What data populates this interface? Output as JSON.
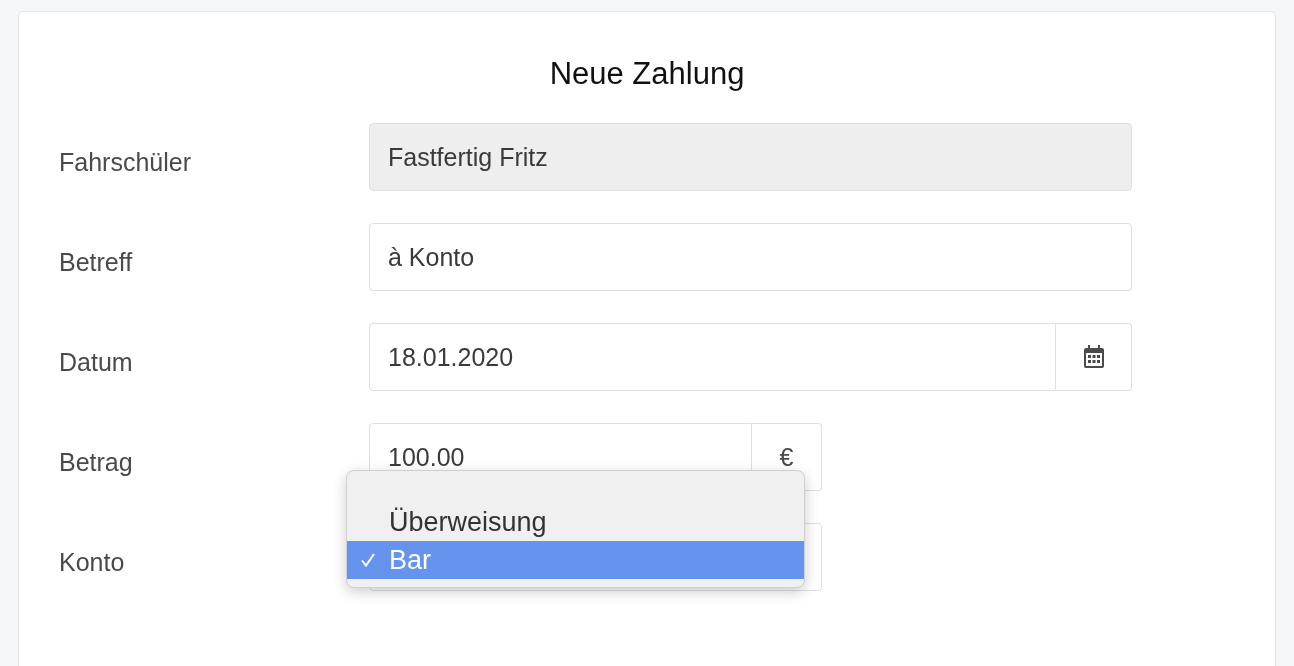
{
  "title": "Neue Zahlung",
  "fields": [
    {
      "kind": "readonly",
      "label": "Fahrschüler",
      "value": "Fastfertig Fritz"
    },
    {
      "kind": "text",
      "label": "Betreff",
      "value": "à Konto"
    },
    {
      "kind": "date",
      "label": "Datum",
      "value": "18.01.2020"
    },
    {
      "kind": "amount",
      "label": "Betrag",
      "value": "100.00",
      "addon": "€"
    },
    {
      "kind": "select",
      "label": "Konto",
      "options": [
        {
          "label": "Überweisung",
          "selected": false
        },
        {
          "label": "Bar",
          "selected": true
        }
      ]
    }
  ]
}
